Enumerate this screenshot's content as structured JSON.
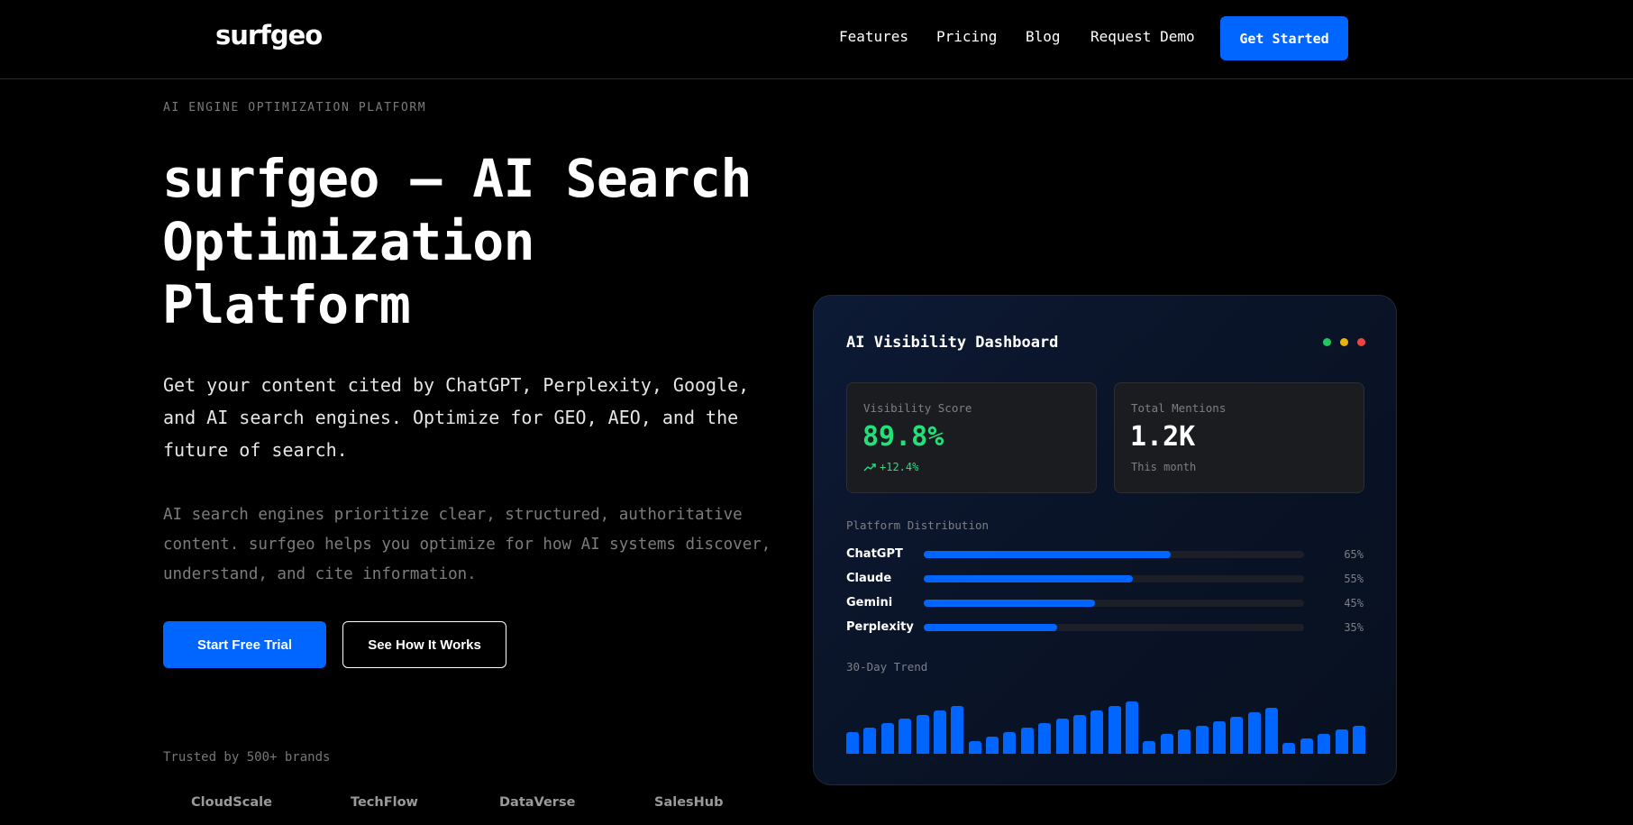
{
  "nav": {
    "logo": "surfgeo",
    "links": [
      "Features",
      "Pricing",
      "Blog",
      "Request Demo"
    ],
    "cta": "Get Started"
  },
  "hero": {
    "eyebrow": "AI ENGINE OPTIMIZATION PLATFORM",
    "headline": "surfgeo — AI Search Optimization Platform",
    "lead": "Get your content cited by ChatGPT, Perplexity, Google, and AI search engines. Optimize for GEO, AEO, and the future of search.",
    "sub": "AI search engines prioritize clear, structured, authoritative content. surfgeo helps you optimize for how AI systems discover, understand, and cite information.",
    "primary_cta": "Start Free Trial",
    "secondary_cta": "See How It Works",
    "trusted_label": "Trusted by 500+ brands",
    "brands": [
      "CloudScale",
      "TechFlow",
      "DataVerse",
      "SalesHub"
    ]
  },
  "dashboard": {
    "title": "AI Visibility Dashboard",
    "window_dot_colors": [
      "#22c55e",
      "#eab308",
      "#ef4444"
    ],
    "visibility": {
      "label": "Visibility Score",
      "value": "89.8%",
      "change": "+12.4%",
      "value_color": "#22e07a"
    },
    "mentions": {
      "label": "Total Mentions",
      "value": "1.2K",
      "foot": "This month"
    },
    "distribution_label": "Platform Distribution",
    "platforms": [
      {
        "name": "ChatGPT",
        "pct_label": "65%",
        "pct": 0.65
      },
      {
        "name": "Claude",
        "pct_label": "55%",
        "pct": 0.55
      },
      {
        "name": "Gemini",
        "pct_label": "45%",
        "pct": 0.45
      },
      {
        "name": "Perplexity",
        "pct_label": "35%",
        "pct": 0.35
      }
    ],
    "trend_label": "30-Day Trend",
    "trend_values": [
      40,
      48,
      56,
      64,
      72,
      80,
      88,
      24,
      32,
      40,
      48,
      56,
      64,
      72,
      80,
      88,
      96,
      24,
      36,
      44,
      52,
      60,
      68,
      76,
      84,
      20,
      28,
      36,
      44,
      52
    ],
    "accent": "#0066ff"
  }
}
